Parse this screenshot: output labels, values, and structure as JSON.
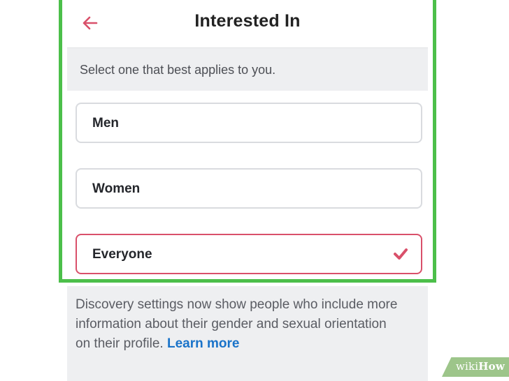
{
  "header": {
    "title": "Interested In",
    "back_icon": "arrow-left-icon"
  },
  "subheader": {
    "text": "Select one that best applies to you."
  },
  "options": [
    {
      "label": "Men",
      "selected": false
    },
    {
      "label": "Women",
      "selected": false
    },
    {
      "label": "Everyone",
      "selected": true
    }
  ],
  "selected_icon": "checkmark-icon",
  "info": {
    "text": "Discovery settings now show people who include more information about their gender and sexual orientation on their profile.",
    "link_label": "Learn more"
  },
  "colors": {
    "accent": "#d9506a",
    "link": "#1a73c9",
    "highlight": "#4cbf4a"
  },
  "watermark": {
    "prefix": "wiki",
    "suffix": "How"
  }
}
